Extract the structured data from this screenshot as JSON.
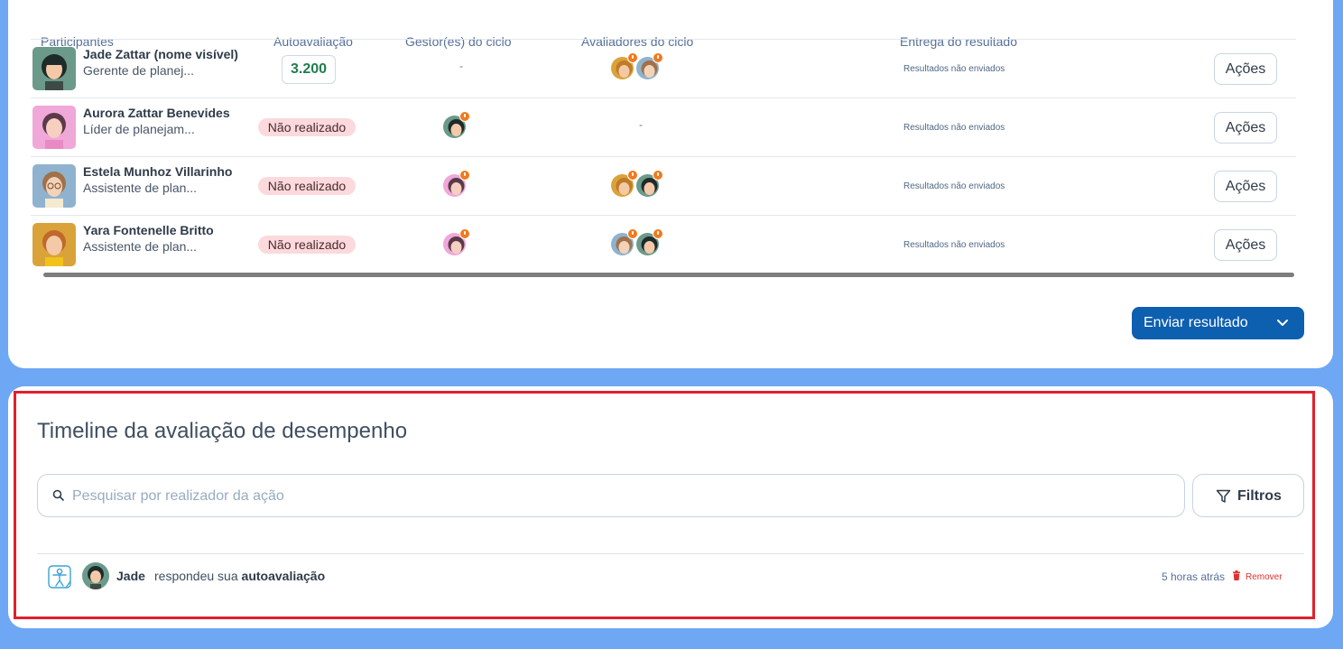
{
  "table": {
    "headers": {
      "participants": "Participantes",
      "self_eval": "Autoavaliação",
      "managers": "Gestor(es) do ciclo",
      "evaluators": "Avaliadores do ciclo",
      "delivery": "Entrega do resultado"
    },
    "rows": [
      {
        "name": "Jade Zattar (nome visível)",
        "role": "Gerente de planej...",
        "self_eval": "3.200",
        "manager": "-",
        "evaluators": "",
        "delivery": "Resultados não enviados",
        "action": "Ações"
      },
      {
        "name": "Aurora Zattar Benevides",
        "role": "Líder de planejam...",
        "self_eval": "Não realizado",
        "manager": "",
        "evaluators": "-",
        "delivery": "Resultados não enviados",
        "action": "Ações"
      },
      {
        "name": "Estela Munhoz Villarinho",
        "role": "Assistente de plan...",
        "self_eval": "Não realizado",
        "manager": "",
        "evaluators": "",
        "delivery": "Resultados não enviados",
        "action": "Ações"
      },
      {
        "name": "Yara Fontenelle Britto",
        "role": "Assistente de plan...",
        "self_eval": "Não realizado",
        "manager": "",
        "evaluators": "",
        "delivery": "Resultados não enviados",
        "action": "Ações"
      }
    ]
  },
  "send_button": {
    "label": "Enviar resultado"
  },
  "timeline": {
    "title": "Timeline da avaliação de desempenho",
    "search_placeholder": "Pesquisar por realizador da ação",
    "filters_label": "Filtros",
    "entries": [
      {
        "user": "Jade",
        "action_prefix": "respondeu sua",
        "action_object": "autoavaliação",
        "time": "5 horas atrás",
        "remove_label": "Remover"
      }
    ]
  },
  "colors": {
    "primary": "#0d5fb0",
    "highlight": "#e0202b",
    "badge_bg": "#fbd9dc",
    "score_text": "#1f7d4e",
    "pending_clock": "#f07a1e",
    "page_bg": "#6ea7f4"
  },
  "icons": [
    "search-icon",
    "filter-icon",
    "chevron-down-icon",
    "trash-icon",
    "clock-icon",
    "person-evaluation-icon"
  ]
}
